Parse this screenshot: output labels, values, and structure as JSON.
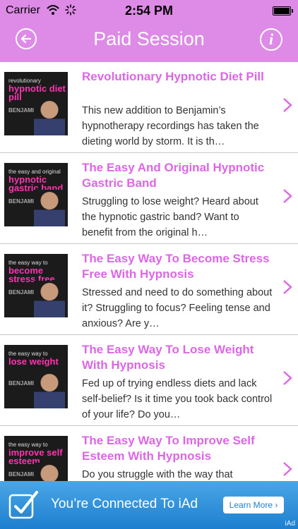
{
  "status_bar": {
    "carrier": "Carrier",
    "time": "2:54 PM"
  },
  "nav_bar": {
    "title": "Paid Session",
    "info_label": "i"
  },
  "items": [
    {
      "thumb_small": "revolutionary",
      "thumb_big": "hypnotic diet pill",
      "thumb_name": "BENJAMIN BONETTI",
      "title": "Revolutionary Hypnotic Diet Pill",
      "desc": "This new addition to Benjamin’s hypnotherapy recordings has taken the dieting world by storm. It is th…"
    },
    {
      "thumb_small": "the easy and original",
      "thumb_big": "hypnotic gastric band",
      "thumb_name": "BENJAMIN BONETTI",
      "title": "The Easy And Original Hypnotic Gastric Band",
      "desc": "Struggling to lose weight? Heard about the hypnotic gastric band? Want to benefit from the original h…"
    },
    {
      "thumb_small": "the easy way to",
      "thumb_big": "become stress free",
      "thumb_name": "BENJAMIN BONETTI",
      "title": "The Easy Way To Become Stress Free With Hypnosis",
      "desc": "Stressed and need to do something about it? Struggling to focus? Feeling tense and anxious?  Are y…"
    },
    {
      "thumb_small": "the easy way to",
      "thumb_big": "lose weight",
      "thumb_name": "BENJAMIN BONETTI",
      "title": "The Easy Way To Lose Weight With Hypnosis",
      "desc": "Fed up of trying endless diets and lack self-belief? Is it time you took back control of your life? Do you…"
    },
    {
      "thumb_small": "the easy way to",
      "thumb_big": "improve self esteem",
      "thumb_name": "BENJAMIN BONETTI",
      "title": "The Easy Way To Improve Self Esteem With Hypnosis",
      "desc": "Do you struggle with the way that"
    }
  ],
  "ad_banner": {
    "text": "You’re Connected To iAd",
    "button": "Learn More ›",
    "tag": "iAd"
  },
  "colors": {
    "accent": "#dd8be6",
    "title_text": "#dd66e6",
    "ad_blue": "#1d7fcf"
  }
}
